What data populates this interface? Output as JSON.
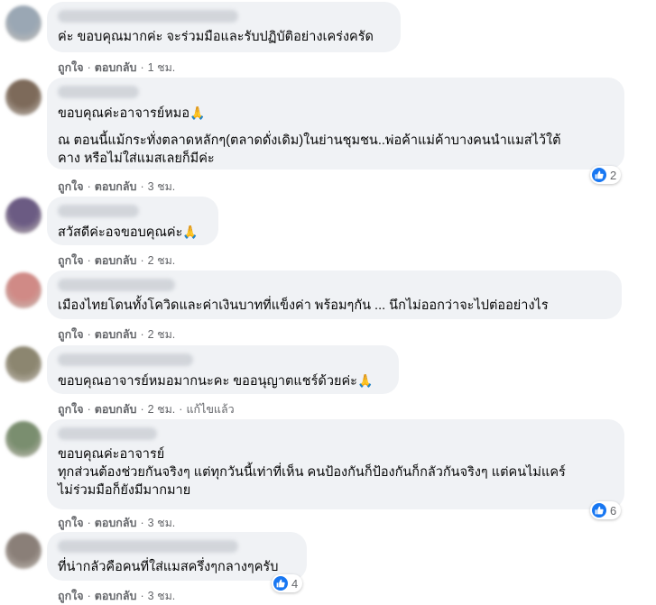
{
  "comments": [
    {
      "avatar_color": "#9aa7b4",
      "lines": [
        "ค่ะ ขอบคุณมากค่ะ จะร่วมมือและรับปฏิบัติอย่างเคร่งครัด"
      ],
      "like_label": "ถูกใจ",
      "reply_label": "ตอบกลับ",
      "time": "1 ชม."
    },
    {
      "avatar_color": "#7d6a5a",
      "lines": [
        "ขอบคุณค่ะอาจารย์หมอ"
      ],
      "emoji": "🙏",
      "paragraph": [
        "ณ ตอนนี้แม้กระทั่งตลาดหลักๆ(ตลาดดั่งเดิม)ในย่านชุมชน..พ่อค้าแม่ค้าบางคนนำแมสไว้ใต้",
        "คาง หรือไม่ใส่แมสเลยก็มีค่ะ"
      ],
      "like_label": "ถูกใจ",
      "reply_label": "ตอบกลับ",
      "time": "3 ชม.",
      "reaction_count": "2"
    },
    {
      "avatar_color": "#6b5b83",
      "lines": [
        "สวัสดีค่ะอจขอบคุณค่ะ"
      ],
      "emoji": "🙏",
      "like_label": "ถูกใจ",
      "reply_label": "ตอบกลับ",
      "time": "2 ชม."
    },
    {
      "avatar_color": "#d08a86",
      "lines": [
        "เมืองไทยโดนทั้งโควิดและค่าเงินบาทที่แข็งค่า พร้อมๆกัน ... นึกไม่ออกว่าจะไปต่ออย่างไร"
      ],
      "like_label": "ถูกใจ",
      "reply_label": "ตอบกลับ",
      "time": "2 ชม."
    },
    {
      "avatar_color": "#8c8670",
      "lines": [
        "ขอบคุณอาจารย์หมอมากนะคะ ขออนุญาตแชร์ด้วยค่ะ"
      ],
      "emoji": "🙏",
      "like_label": "ถูกใจ",
      "reply_label": "ตอบกลับ",
      "time": "2 ชม.",
      "edited_label": "แก้ไขแล้ว"
    },
    {
      "avatar_color": "#7a8e6f",
      "lines": [
        "ขอบคุณค่ะอาจารย์",
        "ทุกส่วนต้องช่วยกันจริงๆ แต่ทุกวันนี้เท่าที่เห็น คนป้องกันก็ป้องกันก็กลัวกันจริงๆ แต่คนไม่แคร์",
        "ไม่ร่วมมือก็ยังมีมากมาย"
      ],
      "like_label": "ถูกใจ",
      "reply_label": "ตอบกลับ",
      "time": "3 ชม.",
      "reaction_count": "6"
    },
    {
      "avatar_color": "#8a7f78",
      "lines": [
        "ที่น่ากลัวคือคนที่ใส่แมสครึ่งๆกลางๆครับ"
      ],
      "like_label": "ถูกใจ",
      "reply_label": "ตอบกลับ",
      "time": "3 ชม.",
      "reaction_count": "4"
    }
  ]
}
